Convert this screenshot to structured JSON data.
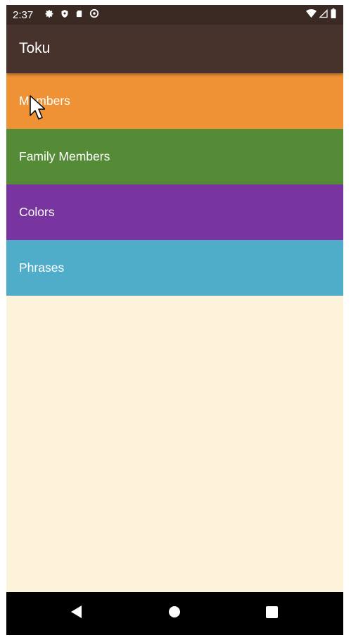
{
  "status_bar": {
    "time": "2:37",
    "left_icons": [
      "gear-icon",
      "shield-icon",
      "sd-card-icon",
      "data-saver-icon"
    ],
    "right_icons": [
      "wifi-icon",
      "signal-icon",
      "battery-icon"
    ]
  },
  "app_bar": {
    "title": "Toku",
    "color": "#48332c"
  },
  "categories": [
    {
      "label": "Members",
      "color": "#ef9235"
    },
    {
      "label": "Family Members",
      "color": "#558b37"
    },
    {
      "label": "Colors",
      "color": "#79359f"
    },
    {
      "label": "Phrases",
      "color": "#50adc9"
    }
  ],
  "background_color": "#fdf3db",
  "nav_bar": {
    "buttons": [
      "back-icon",
      "home-icon",
      "recents-icon"
    ]
  }
}
